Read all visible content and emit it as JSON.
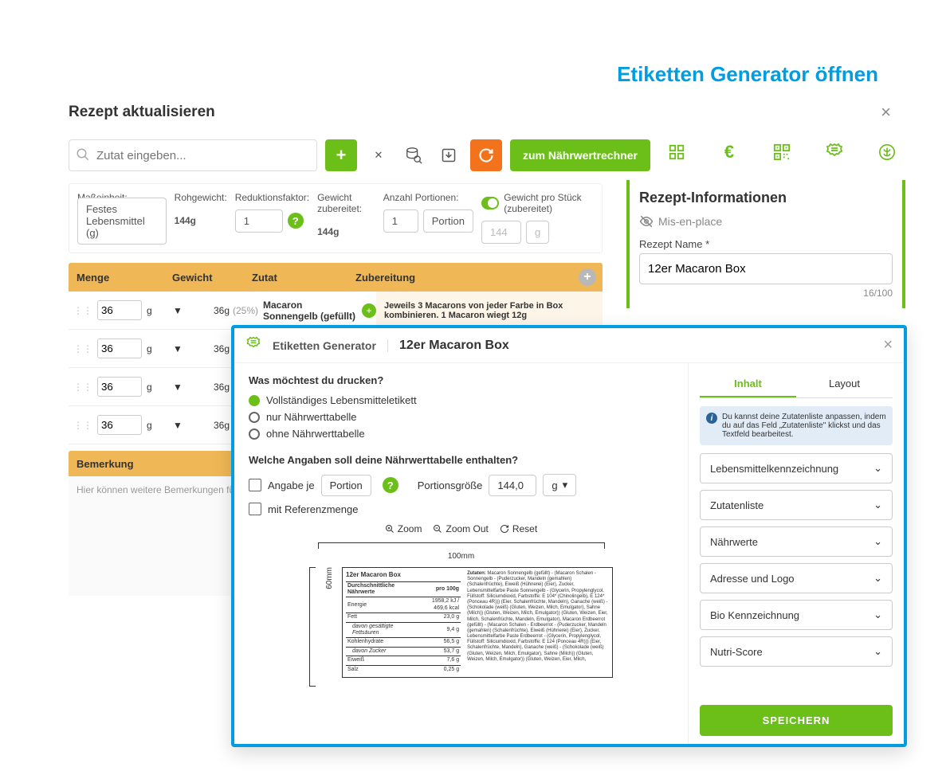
{
  "annotation": {
    "headline": "Etiketten Generator öffnen"
  },
  "panel": {
    "title": "Rezept aktualisieren",
    "search_placeholder": "Zutat eingeben...",
    "calc_button": "zum Nährwertrechner"
  },
  "fields": {
    "mass_label": "Maßeinheit:",
    "mass_value": "Festes Lebensmittel (g)",
    "raw_label": "Rohgewicht:",
    "raw_value": "144g",
    "reduce_label": "Reduktionsfaktor:",
    "reduce_value": "1",
    "cooked_label": "Gewicht zubereitet:",
    "cooked_value": "144g",
    "portions_label": "Anzahl Portionen:",
    "portions_value": "1",
    "portion_unit": "Portion",
    "perpiece_label": "Gewicht pro Stück (zubereitet)",
    "perpiece_value": "144",
    "perpiece_unit": "g"
  },
  "info": {
    "section": "Rezept-Informationen",
    "mis": "Mis-en-place",
    "name_label": "Rezept Name *",
    "name_value": "12er Macaron Box",
    "counter": "16/100"
  },
  "table": {
    "hdr": {
      "menge": "Menge",
      "gewicht": "Gewicht",
      "zutat": "Zutat",
      "zubereitung": "Zubereitung"
    },
    "rows": [
      {
        "qty": "36",
        "unit": "g",
        "weight": "36g",
        "pct": "(25%)",
        "name": "Macaron Sonnengelb (gefüllt)",
        "prep": "Jeweils 3 Macarons von jeder Farbe in Box kombinieren. 1 Macaron wiegt 12g"
      },
      {
        "qty": "36",
        "unit": "g",
        "weight": "36g",
        "pct": "",
        "name": "",
        "prep": ""
      },
      {
        "qty": "36",
        "unit": "g",
        "weight": "36g",
        "pct": "",
        "name": "",
        "prep": ""
      },
      {
        "qty": "36",
        "unit": "g",
        "weight": "36g",
        "pct": "",
        "name": "",
        "prep": ""
      }
    ]
  },
  "remarks": {
    "title": "Bemerkung",
    "placeholder": "Hier können weitere Bemerkungen für dein R"
  },
  "modal": {
    "label": "Etiketten Generator",
    "title": "12er Macaron Box",
    "q1": "Was möchtest du drucken?",
    "opt1": "Vollständiges Lebensmitteletikett",
    "opt2": "nur Nährwerttabelle",
    "opt3": "ohne Nährwerttabelle",
    "q2": "Welche Angaben soll deine Nährwerttabelle enthalten?",
    "per_label": "Angabe je",
    "per_value": "Portion",
    "size_label": "Portionsgröße",
    "size_value": "144,0",
    "size_unit": "g",
    "ref_label": "mit Referenzmenge",
    "zoom_in": "Zoom",
    "zoom_out": "Zoom Out",
    "reset": "Reset",
    "width": "100mm",
    "height": "60mm",
    "tabs": {
      "inhalt": "Inhalt",
      "layout": "Layout"
    },
    "tip": "Du kannst deine Zutatenliste anpassen, indem du auf das Feld „Zutatenliste\" klickst und das Textfeld bearbeitest.",
    "acc": [
      "Lebensmittelkennzeichnung",
      "Zutatenliste",
      "Nährwerte",
      "Adresse und Logo",
      "Bio Kennzeichnung",
      "Nutri-Score"
    ],
    "save": "SPEICHERN"
  },
  "chart_data": {
    "type": "table",
    "title": "12er Macaron Box",
    "header_left": "Durchschnittliche Nährwerte",
    "header_right": "pro 100g",
    "rows": [
      {
        "label": "Energie",
        "value": "1958,2 kJ / 469,6 kcal"
      },
      {
        "label": "Fett",
        "value": "23,0 g"
      },
      {
        "label": "davon gesättigte Fettsäuren",
        "value": "9,4 g",
        "indent": true
      },
      {
        "label": "Kohlenhydrate",
        "value": "56,5 g"
      },
      {
        "label": "davon Zucker",
        "value": "53,7 g",
        "indent": true
      },
      {
        "label": "Eiweiß",
        "value": "7,6 g"
      },
      {
        "label": "Salz",
        "value": "0,25 g"
      }
    ],
    "ingredients_intro": "Zutaten:",
    "ingredients": "Macaron Sonnengelb (gefüllt) - (Macaron Schalen - Sonnengelb - (Puderzucker, Mandeln (gemahlen) (Schalenfrüchte), Eiweiß (Hühnerei) (Eier), Zucker, Lebensmittelfarbe Paste Sonnengelb - (Glycerin, Propylenglycol, Füllstoff: Siliciumdioxid, Farbstoffe: E 104* (Chinolingelb), E 124* (Ponceau 4R))) (Eier, Schalenfrüchte, Mandeln), Ganache (weiß) - (Schokolade (weiß) (Gluten, Weizen, Milch, Emulgator), Sahne (Milch)) (Gluten, Weizen, Milch, Emulgator)) (Gluten, Weizen, Eier, Milch, Schalenfrüchte, Mandeln, Emulgator), Macaron Erdbeerrot (gefüllt) - (Macaron Schalen - Erdbeerrot - (Puderzucker, Mandeln (gemahlen) (Schalenfrüchte), Eiweiß (Hühnerei) (Eier), Zucker, Lebensmittelfarbe Paste Erdbeerrot - (Glycerin, Propylenglycol, Füllstoff: Siliciumdioxid, Farbstoffe: E 124 (Ponceau 4R))) (Eier, Schalenfrüchte, Mandeln), Ganache (weiß) - (Schokolade (weiß) (Gluten, Weizen, Milch, Emulgator), Sahne (Milch)) (Gluten, Weizen, Milch, Emulgator)) (Gluten, Weizen, Eier, Milch,"
  }
}
